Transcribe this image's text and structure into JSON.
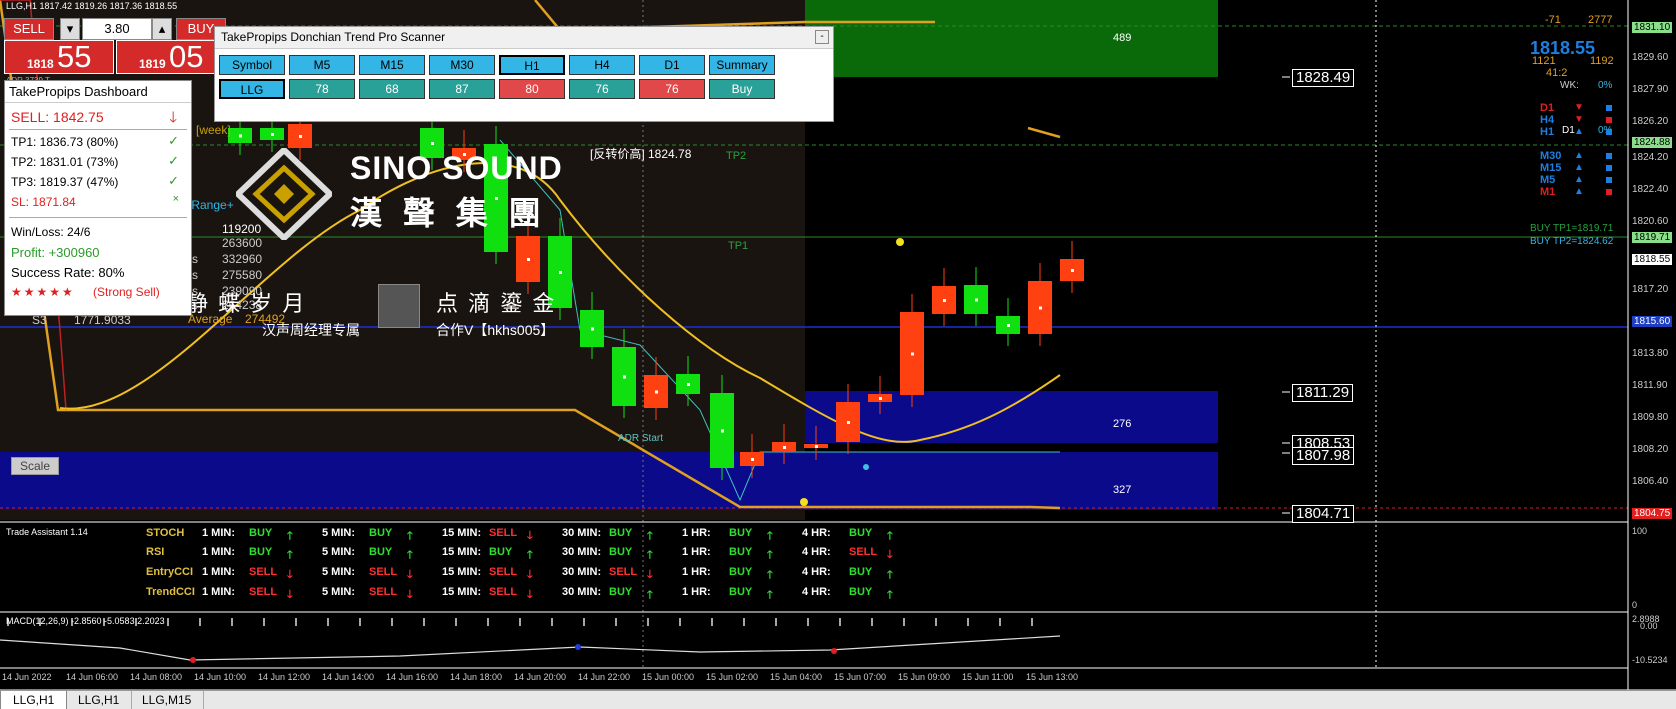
{
  "symbol_header": "LLG,H1  1817.42 1819.26 1817.36 1818.55",
  "trade_panel": {
    "sell_label": "SELL",
    "buy_label": "BUY",
    "lot": "3.80",
    "sell_prefix": "1818",
    "sell_big": "55",
    "buy_prefix": "1819",
    "buy_big": "05",
    "adr_line": "ADR 3739  T..."
  },
  "dashboard": {
    "title": "TakePropips Dashboard",
    "sell": "SELL: 1842.75",
    "tp1": "TP1: 1836.73 (80%)",
    "tp2": "TP2: 1831.01 (73%)",
    "tp3": "TP3: 1819.37 (47%)",
    "sl": "SL:  1871.84",
    "winloss": "Win/Loss: 24/6",
    "profit": "Profit: +300960",
    "success": "Success Rate: 80%",
    "stars": "★★★★★",
    "strength": "(Strong Sell)"
  },
  "scanner": {
    "title": "TakePropips Donchian Trend Pro Scanner",
    "headers": [
      "Symbol",
      "M5",
      "M15",
      "M30",
      "H1",
      "H4",
      "D1",
      "Summary"
    ],
    "values": [
      "LLG",
      "78",
      "68",
      "87",
      "80",
      "76",
      "76",
      "Buy"
    ],
    "colors": [
      "#33b5e5",
      "#2aa198",
      "#2aa198",
      "#2aa198",
      "#e0484a",
      "#2aa198",
      "#e0484a",
      "#2aa198"
    ]
  },
  "overlay_text": {
    "week": "[week]",
    "range": "y Range+",
    "s3": "S3",
    "s3_val": "1771.9033",
    "reverse": "[反转价高] 1824.78",
    "avg_label": "Average",
    "avg_val": "274492",
    "days": [
      "119200",
      "263600",
      "332960",
      "275580",
      "239090",
      "264238"
    ],
    "ys": "ys",
    "chinese1": "静  蝶  岁  月",
    "chinese2": "点  滴  鎏  金",
    "manager": "汉声周经理专属",
    "coop": "合作V【hkhs005】",
    "brand_en": "SINO SOUND",
    "brand_cn": "漢 聲 集 團",
    "tp1": "TP1",
    "tp2": "TP2",
    "adr_start": "ADR Start",
    "box1_val": "489",
    "box2_val": "276",
    "box3_val": "327",
    "lines": [
      "1828.49",
      "1811.29",
      "1808.53",
      "1807.98",
      "1804.71"
    ],
    "buy_tp1": "BUY TP1=1819.71",
    "buy_tp2": "BUY TP2=1824.62",
    "scale": "Scale"
  },
  "right_panel": {
    "top": [
      "-71",
      "2777"
    ],
    "price": "1818.55",
    "mid": [
      "1121",
      "1192"
    ],
    "ratio": "41:2",
    "wk": "WK:",
    "wk_pct": "0%",
    "tf": [
      "D1",
      "H4",
      "H1",
      "M30",
      "M15",
      "M5",
      "M1"
    ],
    "d1_lbl": "D1",
    "d1_pct": "0%"
  },
  "price_axis": [
    "1831.10",
    "1829.60",
    "1827.90",
    "1826.20",
    "1824.88",
    "1824.20",
    "1822.40",
    "1820.60",
    "1819.71",
    "1818.55",
    "1817.20",
    "1815.60",
    "1813.80",
    "1811.90",
    "1809.80",
    "1808.20",
    "1806.40",
    "1804.75"
  ],
  "trade_assistant": {
    "title": "Trade Assistant 1.14",
    "rows": [
      {
        "name": "STOCH",
        "cells": [
          [
            "1 MIN:",
            "BUY",
            "up"
          ],
          [
            "5 MIN:",
            "BUY",
            "up"
          ],
          [
            "15 MIN:",
            "SELL",
            "down"
          ],
          [
            "30 MIN:",
            "BUY",
            "up"
          ],
          [
            "1 HR:",
            "BUY",
            "up"
          ],
          [
            "4 HR:",
            "BUY",
            "up"
          ]
        ]
      },
      {
        "name": "RSI",
        "cells": [
          [
            "1 MIN:",
            "BUY",
            "up"
          ],
          [
            "5 MIN:",
            "BUY",
            "up"
          ],
          [
            "15 MIN:",
            "BUY",
            "up"
          ],
          [
            "30 MIN:",
            "BUY",
            "up"
          ],
          [
            "1 HR:",
            "BUY",
            "up"
          ],
          [
            "4 HR:",
            "SELL",
            "down"
          ]
        ]
      },
      {
        "name": "EntryCCI",
        "cells": [
          [
            "1 MIN:",
            "SELL",
            "down"
          ],
          [
            "5 MIN:",
            "SELL",
            "down"
          ],
          [
            "15 MIN:",
            "SELL",
            "down"
          ],
          [
            "30 MIN:",
            "SELL",
            "down"
          ],
          [
            "1 HR:",
            "BUY",
            "up"
          ],
          [
            "4 HR:",
            "BUY",
            "up"
          ]
        ]
      },
      {
        "name": "TrendCCI",
        "cells": [
          [
            "1 MIN:",
            "SELL",
            "down"
          ],
          [
            "5 MIN:",
            "SELL",
            "down"
          ],
          [
            "15 MIN:",
            "SELL",
            "down"
          ],
          [
            "30 MIN:",
            "BUY",
            "up"
          ],
          [
            "1 HR:",
            "BUY",
            "up"
          ],
          [
            "4 HR:",
            "BUY",
            "up"
          ]
        ]
      }
    ],
    "axis_top": "100",
    "axis_bottom": "0"
  },
  "macd": {
    "label": "MACD(12,26,9) -2.8560 -5.0583 2.2023",
    "axis": [
      "2.8988",
      "0.00",
      "-10.5234"
    ]
  },
  "time_axis": [
    "14 Jun 2022",
    "14 Jun 06:00",
    "14 Jun 08:00",
    "14 Jun 10:00",
    "14 Jun 12:00",
    "14 Jun 14:00",
    "14 Jun 16:00",
    "14 Jun 18:00",
    "14 Jun 20:00",
    "14 Jun 22:00",
    "15 Jun 00:00",
    "15 Jun 02:00",
    "15 Jun 04:00",
    "15 Jun 07:00",
    "15 Jun 09:00",
    "15 Jun 11:00",
    "15 Jun 13:00"
  ],
  "tabs": [
    "LLG,H1",
    "LLG,H1",
    "LLG,M15"
  ]
}
